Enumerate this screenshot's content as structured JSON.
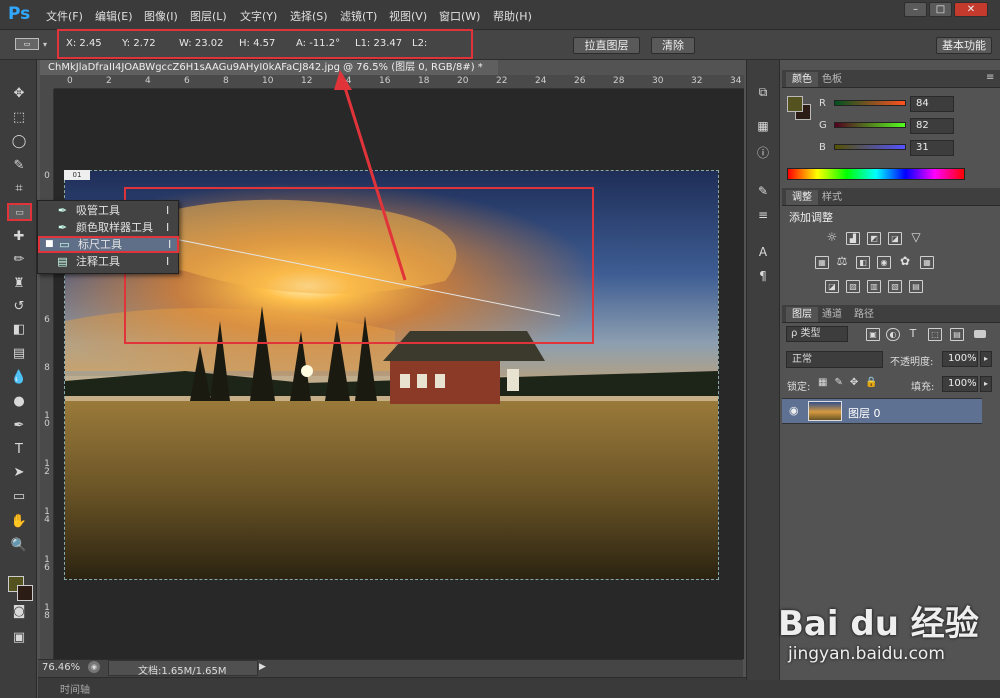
{
  "app": {
    "logo": "Ps"
  },
  "menus": [
    "文件(F)",
    "编辑(E)",
    "图像(I)",
    "图层(L)",
    "文字(Y)",
    "选择(S)",
    "滤镜(T)",
    "视图(V)",
    "窗口(W)",
    "帮助(H)"
  ],
  "window_controls": [
    "–",
    "□",
    "✕"
  ],
  "options": {
    "x": "X: 2.45",
    "y": "Y: 2.72",
    "w": "W: 23.02",
    "h": "H: 4.57",
    "a": "A: -11.2°",
    "l1": "L1: 23.47",
    "l2": "L2:",
    "straighten_label": "拉直图层",
    "clear_label": "清除",
    "workspace_label": "基本功能"
  },
  "document": {
    "tab_title": "ChMkJlaDfraII4JOABWgccZ6H1sAAGu9AHyI0kAFaCJ842.jpg @ 76.5% (图层 0, RGB/8#) *",
    "close": "×",
    "zoom": "76.46%",
    "doc_info": "文档:1.65M/1.65M",
    "timeline": "时间轴"
  },
  "ruler_top_ticks": [
    "0",
    "2",
    "4",
    "6",
    "8",
    "10",
    "12",
    "14",
    "16",
    "18",
    "20",
    "22",
    "24",
    "26",
    "28",
    "30",
    "32",
    "34"
  ],
  "ruler_left_ticks": [
    "0",
    "2",
    "4",
    "6",
    "8",
    "10",
    "12",
    "14",
    "16",
    "18"
  ],
  "flyout": [
    {
      "label": "吸管工具",
      "key": "I",
      "icon": "eyedropper-icon",
      "active": false
    },
    {
      "label": "颜色取样器工具",
      "key": "I",
      "icon": "color-sampler-icon",
      "active": false
    },
    {
      "label": "标尺工具",
      "key": "I",
      "icon": "ruler-icon",
      "active": true
    },
    {
      "label": "注释工具",
      "key": "I",
      "icon": "note-icon",
      "active": false
    }
  ],
  "color_panel": {
    "tabs": [
      "颜色",
      "色板"
    ],
    "r_label": "R",
    "g_label": "G",
    "b_label": "B",
    "r": "84",
    "g": "82",
    "b": "31",
    "foreground": "#54521f",
    "background": "#2b1d16"
  },
  "adjust_panel": {
    "tabs": [
      "调整",
      "样式"
    ],
    "title": "添加调整"
  },
  "layers_panel": {
    "tabs": [
      "图层",
      "通道",
      "路径"
    ],
    "filter": "ρ 类型",
    "blend": "正常",
    "opacity_label": "不透明度:",
    "opacity": "100%",
    "lock_label": "锁定:",
    "fill_label": "填充:",
    "fill": "100%",
    "layer_name": "图层 0"
  },
  "watermark": {
    "brand": "Bai du 经验",
    "url": "jingyan.baidu.com"
  },
  "colors": {
    "accent_red": "#e1343a",
    "ps_blue": "#31a8ff"
  }
}
